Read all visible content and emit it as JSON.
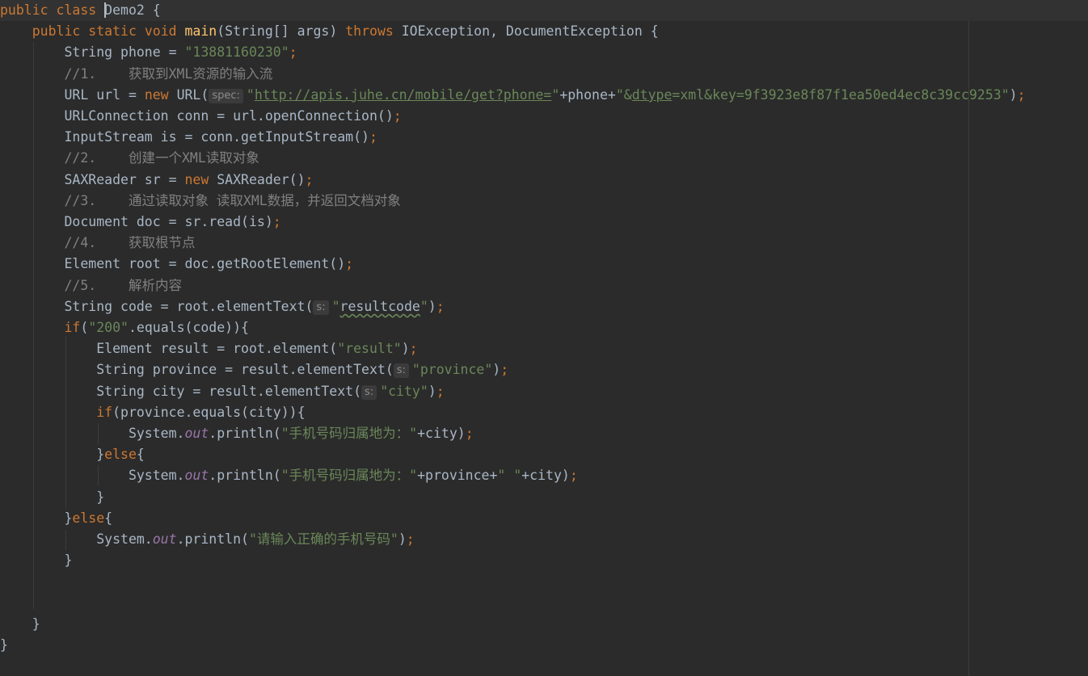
{
  "editor": {
    "lines": [
      [
        {
          "t": "kw",
          "v": "public class "
        },
        {
          "t": "caret"
        },
        {
          "t": "plain",
          "v": "Demo2 {"
        }
      ],
      [
        {
          "t": "plain",
          "v": "    "
        },
        {
          "t": "kw",
          "v": "public static void "
        },
        {
          "t": "fn",
          "v": "main"
        },
        {
          "t": "plain",
          "v": "(String[] args) "
        },
        {
          "t": "kw",
          "v": "throws "
        },
        {
          "t": "plain",
          "v": "IOException, DocumentException {"
        }
      ],
      [
        {
          "t": "plain",
          "v": "        String phone = "
        },
        {
          "t": "str",
          "v": "\"13881160230\""
        },
        {
          "t": "kw",
          "v": ";"
        }
      ],
      [
        {
          "t": "plain",
          "v": "        "
        },
        {
          "t": "cmt",
          "v": "//1.    获取到XML资源的输入流"
        }
      ],
      [
        {
          "t": "plain",
          "v": "        URL url = "
        },
        {
          "t": "kw",
          "v": "new "
        },
        {
          "t": "plain",
          "v": "URL("
        },
        {
          "t": "hint",
          "v": "spec:"
        },
        {
          "t": "str",
          "v": "\""
        },
        {
          "t": "url",
          "v": "http://apis.juhe.cn/mobile/get?phone="
        },
        {
          "t": "str",
          "v": "\""
        },
        {
          "t": "plain",
          "v": "+phone+"
        },
        {
          "t": "str",
          "v": "\"&"
        },
        {
          "t": "url",
          "v": "dtype"
        },
        {
          "t": "str",
          "v": "=xml&key=9f3923e8f87f1ea50ed4ec8c39cc9253\""
        },
        {
          "t": "plain",
          "v": ")"
        },
        {
          "t": "kw",
          "v": ";"
        }
      ],
      [
        {
          "t": "plain",
          "v": "        URLConnection conn = url.openConnection()"
        },
        {
          "t": "kw",
          "v": ";"
        }
      ],
      [
        {
          "t": "plain",
          "v": "        InputStream is = conn.getInputStream()"
        },
        {
          "t": "kw",
          "v": ";"
        }
      ],
      [
        {
          "t": "plain",
          "v": "        "
        },
        {
          "t": "cmt",
          "v": "//2.    创建一个XML读取对象"
        }
      ],
      [
        {
          "t": "plain",
          "v": "        SAXReader sr = "
        },
        {
          "t": "kw",
          "v": "new "
        },
        {
          "t": "plain",
          "v": "SAXReader()"
        },
        {
          "t": "kw",
          "v": ";"
        }
      ],
      [
        {
          "t": "plain",
          "v": "        "
        },
        {
          "t": "cmt",
          "v": "//3.    通过读取对象 读取XML数据，并返回文档对象"
        }
      ],
      [
        {
          "t": "plain",
          "v": "        Document doc = sr.read(is)"
        },
        {
          "t": "kw",
          "v": ";"
        }
      ],
      [
        {
          "t": "plain",
          "v": "        "
        },
        {
          "t": "cmt",
          "v": "//4.    获取根节点"
        }
      ],
      [
        {
          "t": "plain",
          "v": "        Element root = doc.getRootElement()"
        },
        {
          "t": "kw",
          "v": ";"
        }
      ],
      [
        {
          "t": "plain",
          "v": "        "
        },
        {
          "t": "cmt",
          "v": "//5.    解析内容"
        }
      ],
      [
        {
          "t": "plain",
          "v": "        String code = root.elementText("
        },
        {
          "t": "hint",
          "v": "s:"
        },
        {
          "t": "str",
          "v": "\""
        },
        {
          "t": "squig",
          "v": "resultcode"
        },
        {
          "t": "str",
          "v": "\""
        },
        {
          "t": "plain",
          "v": ")"
        },
        {
          "t": "kw",
          "v": ";"
        }
      ],
      [
        {
          "t": "plain",
          "v": "        "
        },
        {
          "t": "kw",
          "v": "if"
        },
        {
          "t": "plain",
          "v": "("
        },
        {
          "t": "str",
          "v": "\"200\""
        },
        {
          "t": "plain",
          "v": ".equals(code)){"
        }
      ],
      [
        {
          "t": "plain",
          "v": "            Element result = root.element("
        },
        {
          "t": "str",
          "v": "\"result\""
        },
        {
          "t": "plain",
          "v": ")"
        },
        {
          "t": "kw",
          "v": ";"
        }
      ],
      [
        {
          "t": "plain",
          "v": "            String province = result.elementText("
        },
        {
          "t": "hint",
          "v": "s:"
        },
        {
          "t": "str",
          "v": "\"province\""
        },
        {
          "t": "plain",
          "v": ")"
        },
        {
          "t": "kw",
          "v": ";"
        }
      ],
      [
        {
          "t": "plain",
          "v": "            String city = result.elementText("
        },
        {
          "t": "hint",
          "v": "s:"
        },
        {
          "t": "str",
          "v": "\"city\""
        },
        {
          "t": "plain",
          "v": ")"
        },
        {
          "t": "kw",
          "v": ";"
        }
      ],
      [
        {
          "t": "plain",
          "v": "            "
        },
        {
          "t": "kw",
          "v": "if"
        },
        {
          "t": "plain",
          "v": "(province.equals(city)){"
        }
      ],
      [
        {
          "t": "plain",
          "v": "                System."
        },
        {
          "t": "fld",
          "v": "out"
        },
        {
          "t": "plain",
          "v": ".println("
        },
        {
          "t": "str",
          "v": "\"手机号码归属地为：\""
        },
        {
          "t": "plain",
          "v": "+city)"
        },
        {
          "t": "kw",
          "v": ";"
        }
      ],
      [
        {
          "t": "plain",
          "v": "            }"
        },
        {
          "t": "kw",
          "v": "else"
        },
        {
          "t": "plain",
          "v": "{"
        }
      ],
      [
        {
          "t": "plain",
          "v": "                System."
        },
        {
          "t": "fld",
          "v": "out"
        },
        {
          "t": "plain",
          "v": ".println("
        },
        {
          "t": "str",
          "v": "\"手机号码归属地为：\""
        },
        {
          "t": "plain",
          "v": "+province+"
        },
        {
          "t": "str",
          "v": "\" \""
        },
        {
          "t": "plain",
          "v": "+city)"
        },
        {
          "t": "kw",
          "v": ";"
        }
      ],
      [
        {
          "t": "plain",
          "v": "            }"
        }
      ],
      [
        {
          "t": "plain",
          "v": "        }"
        },
        {
          "t": "kw",
          "v": "else"
        },
        {
          "t": "plain",
          "v": "{"
        }
      ],
      [
        {
          "t": "plain",
          "v": "            System."
        },
        {
          "t": "fld",
          "v": "out"
        },
        {
          "t": "plain",
          "v": ".println("
        },
        {
          "t": "str",
          "v": "\"请输入正确的手机号码\""
        },
        {
          "t": "plain",
          "v": ")"
        },
        {
          "t": "kw",
          "v": ";"
        }
      ],
      [
        {
          "t": "plain",
          "v": "        }"
        }
      ],
      [],
      [],
      [
        {
          "t": "plain",
          "v": "    }"
        }
      ],
      [
        {
          "t": "plain",
          "v": "}"
        }
      ]
    ]
  }
}
